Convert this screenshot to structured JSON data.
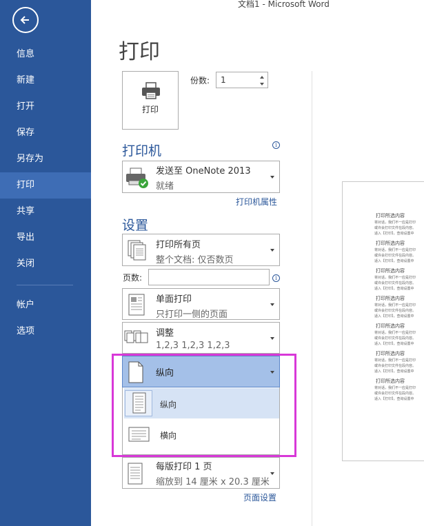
{
  "window": {
    "title": "文档1 - Microsoft Word"
  },
  "sidebar": {
    "items": [
      {
        "label": "信息"
      },
      {
        "label": "新建"
      },
      {
        "label": "打开"
      },
      {
        "label": "保存"
      },
      {
        "label": "另存为"
      },
      {
        "label": "打印",
        "active": true
      },
      {
        "label": "共享"
      },
      {
        "label": "导出"
      },
      {
        "label": "关闭"
      },
      {
        "label": "帐户"
      },
      {
        "label": "选项"
      }
    ]
  },
  "main": {
    "heading": "打印",
    "print_button": "打印",
    "copies_label": "份数:",
    "copies_value": "1"
  },
  "printer": {
    "section_title": "打印机",
    "name": "发送至 OneNote 2013",
    "status": "就绪",
    "properties_link": "打印机属性"
  },
  "settings": {
    "section_title": "设置",
    "print_range": {
      "main": "打印所有页",
      "sub": "整个文档: 仅否数页"
    },
    "pages_label": "页数:",
    "pages_value": "",
    "sides": {
      "main": "单面打印",
      "sub": "只打印一侧的页面"
    },
    "collate": {
      "main": "调整",
      "sub": "1,2,3    1,2,3    1,2,3"
    },
    "orientation": {
      "selected": "纵向",
      "options": [
        {
          "label": "纵向",
          "selected": true
        },
        {
          "label": "横向",
          "selected": false
        }
      ]
    },
    "pages_per_sheet": {
      "main": "每版打印 1 页",
      "sub": "缩放到 14 厘米 x 20.3 厘米"
    },
    "page_setup_link": "页面设置"
  },
  "preview": {
    "blocks": [
      {
        "heading": "打印所选内容",
        "lines": [
          "将对话，我们不一应是打印",
          "或许会打印文件在段内容。",
          "适入【打印】，查询设置中"
        ]
      },
      {
        "heading": "打印所选内容",
        "lines": [
          "将对话，我们不一应是打印",
          "或许会打印文件在段内容。",
          "适入【打印】，查询设置中"
        ]
      },
      {
        "heading": "打印所选内容",
        "lines": [
          "将对话，我们不一应是打印",
          "或许会打印文件在段内容。",
          "适入【打印】，查询设置中"
        ]
      },
      {
        "heading": "打印所选内容",
        "lines": [
          "将对话，我们不一应是打印",
          "或许会打印文件在段内容。",
          "适入【打印】，查询设置中"
        ]
      },
      {
        "heading": "打印所选内容",
        "lines": [
          "将对话，我们不一应是打印",
          "或许会打印文件在段内容。",
          "适入【打印】，查询设置中"
        ]
      },
      {
        "heading": "打印所选内容",
        "lines": [
          "将对话，我们不一应是打印",
          "或许会打印文件在段内容。",
          "适入【打印】，查询设置中"
        ]
      },
      {
        "heading": "打印所选内容",
        "lines": [
          "将对话，我们不一应是打印",
          "或许会打印文件在段内容。",
          "适入【打印】，查询设置中"
        ]
      }
    ]
  },
  "colors": {
    "sidebar": "#2B579A",
    "active_item": "#3E6DB5",
    "accent": "#2B579A",
    "highlight": "#D838D8"
  }
}
